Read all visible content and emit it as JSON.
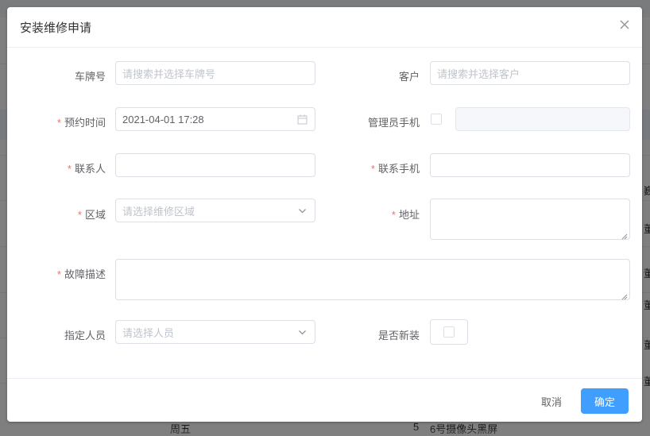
{
  "background": {
    "cells": [
      {
        "text": "巍"
      },
      {
        "text": "董"
      },
      {
        "text": "董"
      },
      {
        "text": "董"
      },
      {
        "text": "董"
      },
      {
        "text": "董"
      },
      {
        "text": "周五"
      },
      {
        "text": "5"
      },
      {
        "text": "6号摄像头黑屏"
      }
    ]
  },
  "dialog": {
    "title": "安装维修申请",
    "close_icon": "close-icon",
    "fields": {
      "plate": {
        "label": "车牌号",
        "placeholder": "请搜索并选择车牌号",
        "value": ""
      },
      "customer": {
        "label": "客户",
        "placeholder": "请搜索并选择客户",
        "value": ""
      },
      "appointment_time": {
        "label": "预约时间",
        "required_mark": "*",
        "value": "2021-04-01 17:28",
        "icon": "calendar-icon"
      },
      "admin_phone": {
        "label": "管理员手机",
        "value": ""
      },
      "contact": {
        "label": "联系人",
        "required_mark": "*",
        "value": ""
      },
      "contact_phone": {
        "label": "联系手机",
        "required_mark": "*",
        "value": ""
      },
      "region": {
        "label": "区域",
        "required_mark": "*",
        "placeholder": "请选择维修区域",
        "icon": "chevron-down-icon"
      },
      "address": {
        "label": "地址",
        "required_mark": "*",
        "value": ""
      },
      "fault": {
        "label": "故障描述",
        "required_mark": "*",
        "value": ""
      },
      "assignee": {
        "label": "指定人员",
        "placeholder": "请选择人员",
        "icon": "chevron-down-icon"
      },
      "is_new_install": {
        "label": "是否新装",
        "checked": false
      }
    },
    "footer": {
      "cancel_label": "取消",
      "confirm_label": "确定"
    }
  },
  "colors": {
    "primary": "#409eff",
    "required": "#f56c6c",
    "border": "#dcdfe6",
    "placeholder": "#c0c4cc"
  }
}
